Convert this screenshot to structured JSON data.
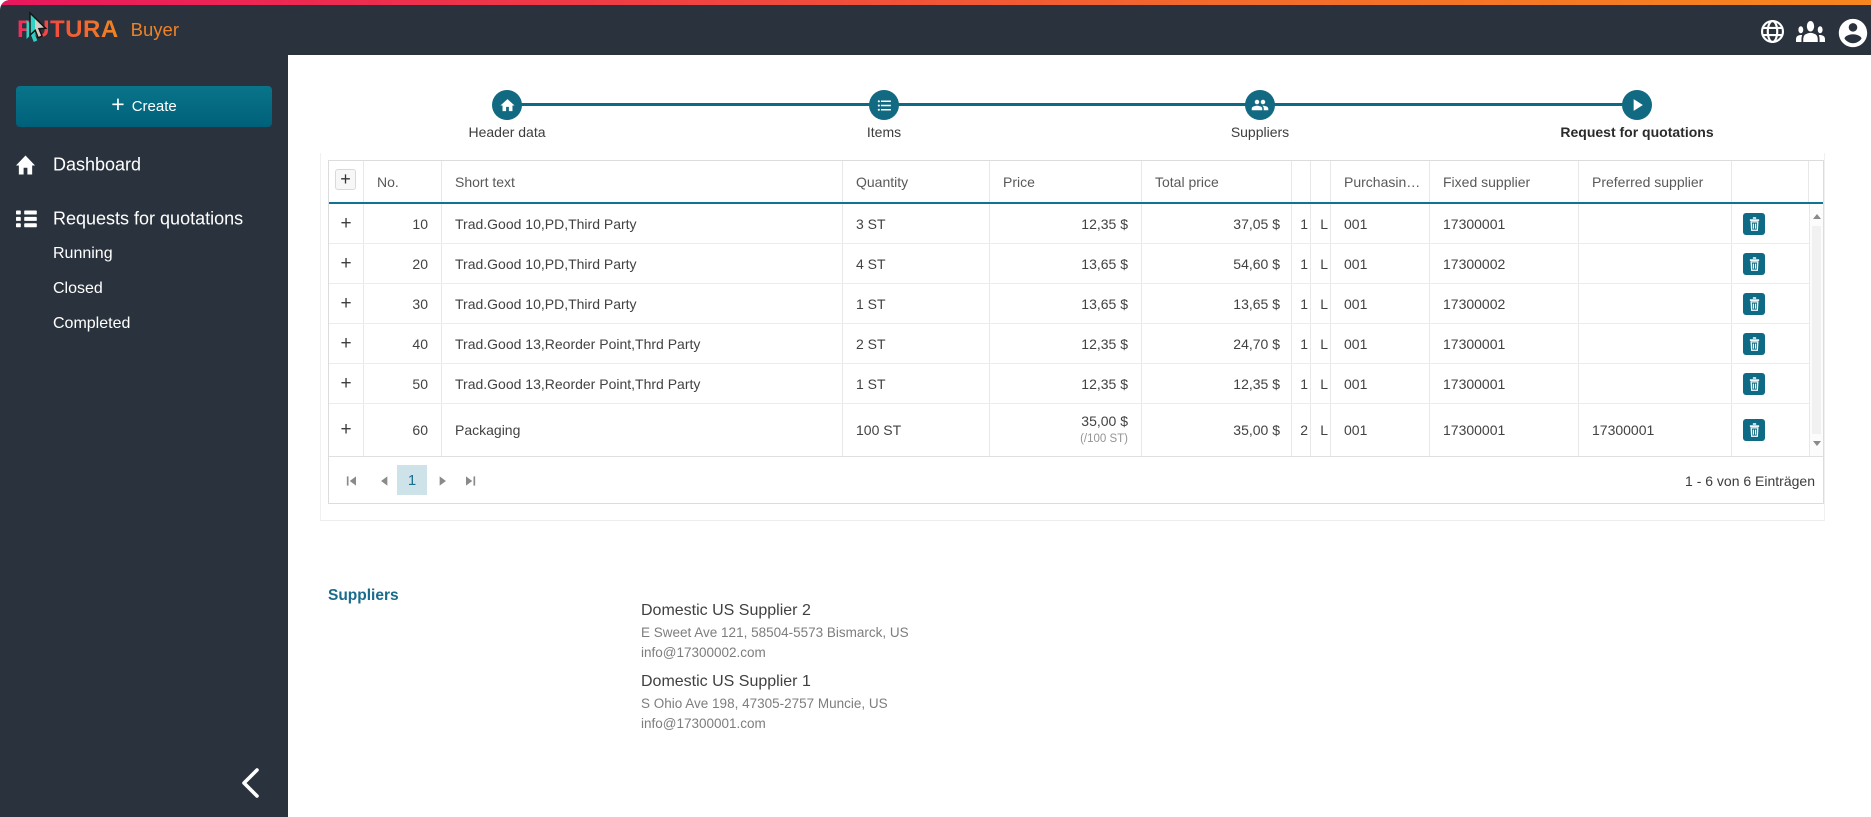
{
  "app": {
    "logo": "FUTURA",
    "logo_suffix": "Buyer"
  },
  "sidebar": {
    "create_label": "Create",
    "items": [
      {
        "label": "Dashboard",
        "icon": "home"
      },
      {
        "label": "Requests for quotations",
        "icon": "list"
      }
    ],
    "subitems": [
      "Running",
      "Closed",
      "Completed"
    ]
  },
  "stepper": {
    "steps": [
      {
        "label": "Header data",
        "icon": "home"
      },
      {
        "label": "Items",
        "icon": "list"
      },
      {
        "label": "Suppliers",
        "icon": "people"
      },
      {
        "label": "Request for quotations",
        "icon": "play"
      }
    ]
  },
  "table": {
    "headers": {
      "no": "No.",
      "short_text": "Short text",
      "quantity": "Quantity",
      "price": "Price",
      "total_price": "Total price",
      "purchasing": "Purchasin…",
      "fixed_supplier": "Fixed supplier",
      "preferred_supplier": "Preferred supplier"
    },
    "rows": [
      {
        "no": "10",
        "short_text": "Trad.Good 10,PD,Third Party",
        "quantity": "3 ST",
        "price": "12,35 $",
        "price_sub": "",
        "total": "37,05 $",
        "n1": "1",
        "n2": "L",
        "purchasing": "001",
        "fixed": "17300001",
        "preferred": ""
      },
      {
        "no": "20",
        "short_text": "Trad.Good 10,PD,Third Party",
        "quantity": "4 ST",
        "price": "13,65 $",
        "price_sub": "",
        "total": "54,60 $",
        "n1": "1",
        "n2": "L",
        "purchasing": "001",
        "fixed": "17300002",
        "preferred": ""
      },
      {
        "no": "30",
        "short_text": "Trad.Good 10,PD,Third Party",
        "quantity": "1 ST",
        "price": "13,65 $",
        "price_sub": "",
        "total": "13,65 $",
        "n1": "1",
        "n2": "L",
        "purchasing": "001",
        "fixed": "17300002",
        "preferred": ""
      },
      {
        "no": "40",
        "short_text": "Trad.Good 13,Reorder Point,Thrd Party",
        "quantity": "2 ST",
        "price": "12,35 $",
        "price_sub": "",
        "total": "24,70 $",
        "n1": "1",
        "n2": "L",
        "purchasing": "001",
        "fixed": "17300001",
        "preferred": ""
      },
      {
        "no": "50",
        "short_text": "Trad.Good 13,Reorder Point,Thrd Party",
        "quantity": "1 ST",
        "price": "12,35 $",
        "price_sub": "",
        "total": "12,35 $",
        "n1": "1",
        "n2": "L",
        "purchasing": "001",
        "fixed": "17300001",
        "preferred": ""
      },
      {
        "no": "60",
        "short_text": "Packaging",
        "quantity": "100 ST",
        "price": "35,00 $",
        "price_sub": "(/100 ST)",
        "total": "35,00 $",
        "n1": "2",
        "n2": "L",
        "purchasing": "001",
        "fixed": "17300001",
        "preferred": "17300001"
      }
    ]
  },
  "pager": {
    "page": "1",
    "info": "1 - 6 von 6 Einträgen"
  },
  "suppliers_section": {
    "title": "Suppliers",
    "suppliers": [
      {
        "name": "Domestic US Supplier 2",
        "address": "E Sweet Ave 121, 58504-5573 Bismarck, US",
        "email": "info@17300002.com"
      },
      {
        "name": "Domestic US Supplier 1",
        "address": "S Ohio Ave 198, 47305-2757 Muncie, US",
        "email": "info@17300001.com"
      }
    ]
  }
}
